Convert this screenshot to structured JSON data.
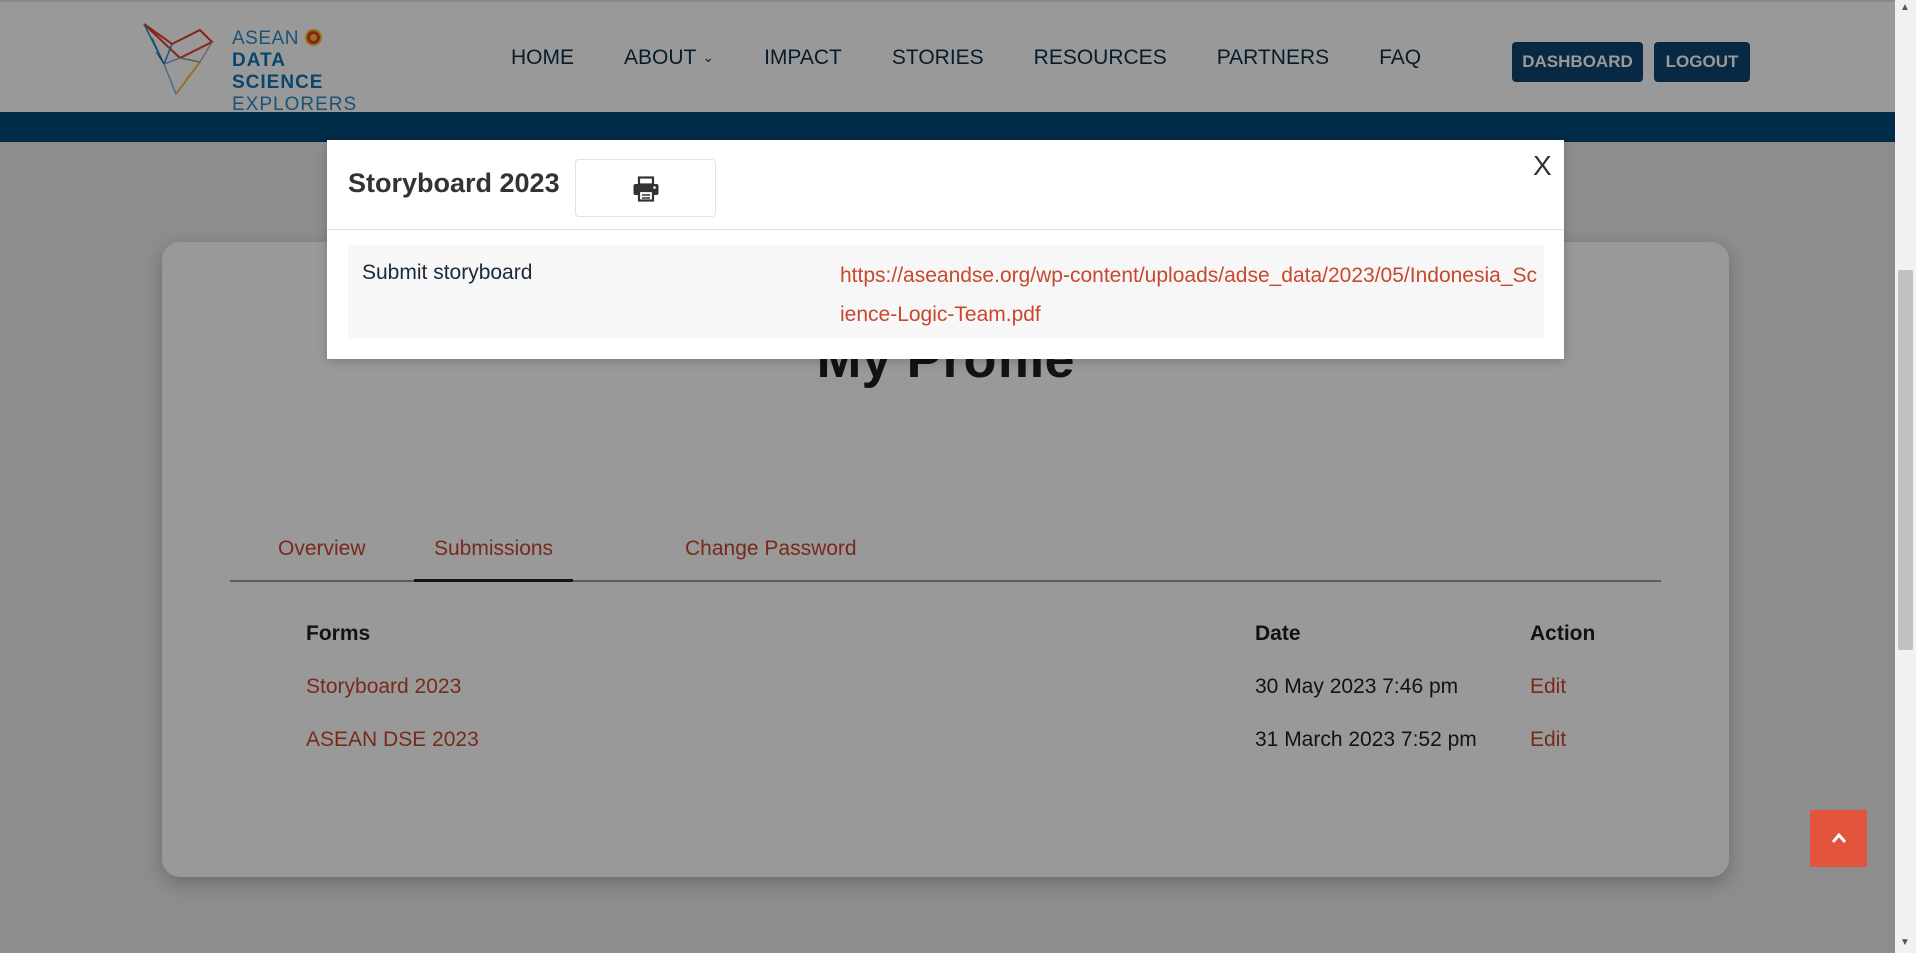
{
  "logo": {
    "line1": "ASEAN",
    "line2": "DATA SCIENCE",
    "line3": "EXPLORERS"
  },
  "nav": {
    "items": [
      {
        "label": "HOME"
      },
      {
        "label": "ABOUT"
      },
      {
        "label": "IMPACT"
      },
      {
        "label": "STORIES"
      },
      {
        "label": "RESOURCES"
      },
      {
        "label": "PARTNERS"
      },
      {
        "label": "FAQ"
      }
    ],
    "dashboard": "DASHBOARD",
    "logout": "LOGOUT"
  },
  "page": {
    "title": "My Profile",
    "tabs": [
      {
        "label": "Overview"
      },
      {
        "label": "Submissions"
      },
      {
        "label": "Change Password"
      }
    ],
    "active_tab": "Submissions",
    "table": {
      "headers": {
        "forms": "Forms",
        "date": "Date",
        "action": "Action"
      },
      "rows": [
        {
          "form": "Storyboard 2023",
          "date": "30 May 2023 7:46 pm",
          "action": "Edit"
        },
        {
          "form": "ASEAN DSE 2023",
          "date": "31 March 2023 7:52 pm",
          "action": "Edit"
        }
      ]
    }
  },
  "modal": {
    "title": "Storyboard 2023",
    "close": "X",
    "print_icon": "print-icon",
    "field_label": "Submit storyboard",
    "field_value": "https://aseandse.org/wp-content/uploads/adse_data/2023/05/Indonesia_Science-Logic-Team.pdf"
  },
  "colors": {
    "navy": "#0d4571",
    "band": "#00497a",
    "accent": "#c9472d",
    "totop": "#e2543c"
  }
}
